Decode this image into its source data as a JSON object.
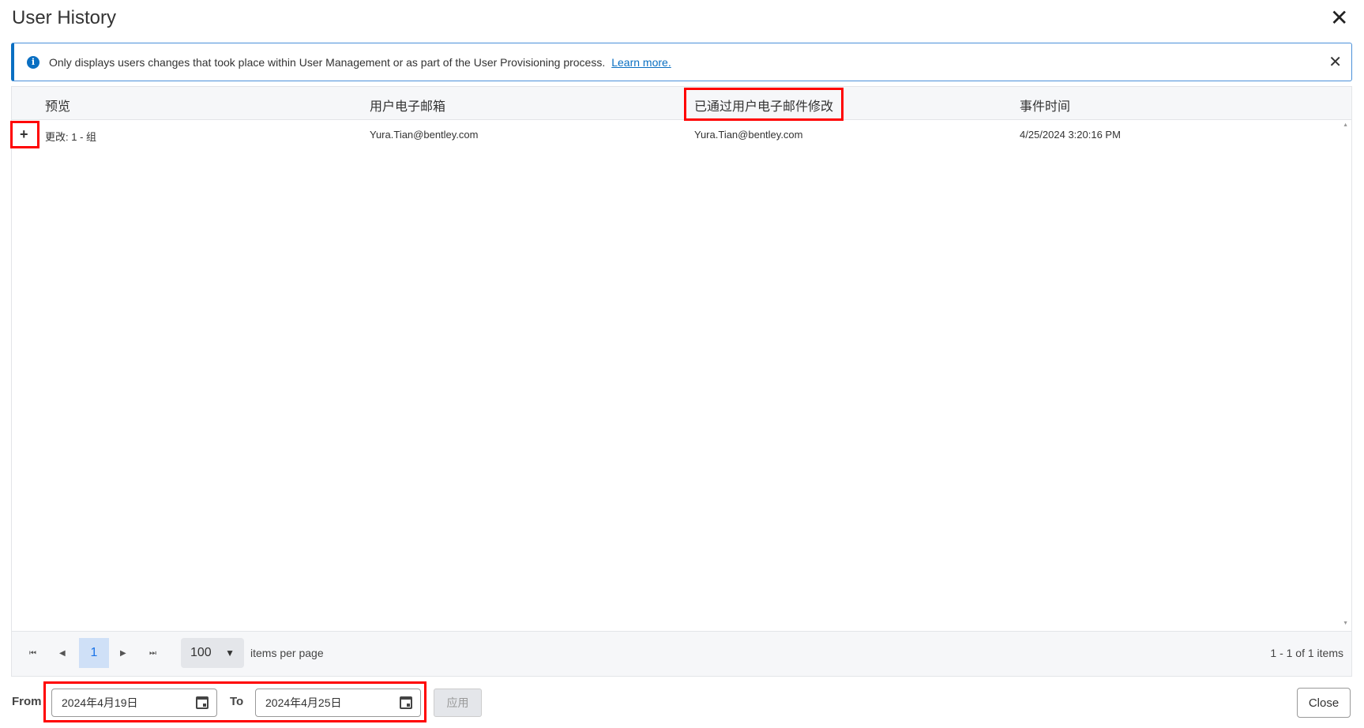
{
  "dialog": {
    "title": "User History"
  },
  "banner": {
    "text": "Only displays users changes that took place within User Management or as part of the User Provisioning process.",
    "link": "Learn more."
  },
  "table": {
    "columns": [
      "预览",
      "用户电子邮箱",
      "已通过用户电子邮件修改",
      "事件时间"
    ],
    "rows": [
      {
        "preview": "更改: 1 - 组",
        "user_email": "Yura.Tian@bentley.com",
        "modified_by": "Yura.Tian@bentley.com",
        "event_time": "4/25/2024 3:20:16 PM"
      }
    ]
  },
  "pager": {
    "current_page": "1",
    "page_size": "100",
    "items_per_page_label": "items per page",
    "summary": "1 - 1 of 1 items"
  },
  "footer": {
    "from_label": "From",
    "from_value": "2024年4月19日",
    "to_label": "To",
    "to_value": "2024年4月25日",
    "apply_label": "应用",
    "close_label": "Close"
  }
}
